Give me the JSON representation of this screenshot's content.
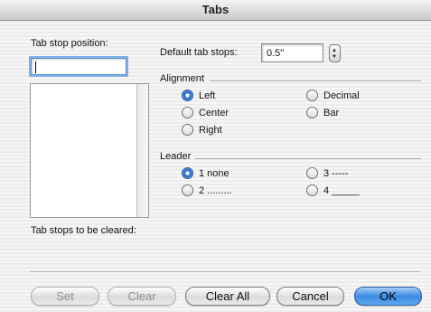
{
  "window": {
    "title": "Tabs"
  },
  "tab_stop_position": {
    "label": "Tab stop position:",
    "value": ""
  },
  "default_tab_stops": {
    "label": "Default tab stops:",
    "value": "0.5\""
  },
  "alignment": {
    "title": "Alignment",
    "options": [
      "Left",
      "Center",
      "Right",
      "Decimal",
      "Bar"
    ],
    "selected": "Left"
  },
  "leader": {
    "title": "Leader",
    "options": [
      "1 none",
      "2 .........",
      "3 -----",
      "4 _____"
    ],
    "selected": "1 none"
  },
  "cleared_label": "Tab stops to be cleared:",
  "buttons": {
    "set": "Set",
    "clear": "Clear",
    "clear_all": "Clear All",
    "cancel": "Cancel",
    "ok": "OK"
  },
  "colors": {
    "accent": "#3c8ae3"
  }
}
